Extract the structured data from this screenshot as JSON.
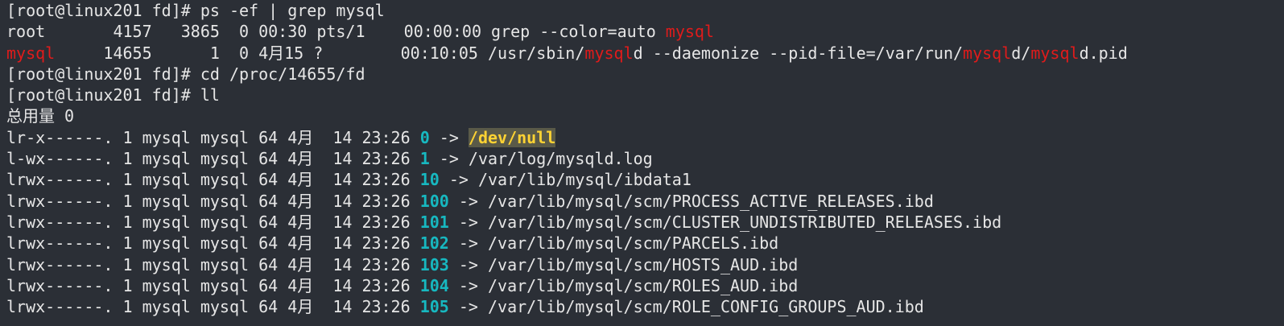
{
  "terminal": {
    "prompt": "[root@linux201 fd]# ",
    "commands": {
      "grep": "ps -ef | grep mysql",
      "cd": "cd /proc/14655/fd",
      "ll": "ll"
    },
    "ps_rows": {
      "grep_row": {
        "prefix": "root       4157   3865  0 00:30 pts/1    00:00:00 grep --color=auto ",
        "match": "mysql"
      },
      "mysqld_row": {
        "user": "mysql",
        "mid1": "     14655      1  0 4月15 ?        00:10:05 /usr/sbin/",
        "m1": "mysql",
        "mid2": "d --daemonize --pid-file=/var/run/",
        "m2": "mysql",
        "mid3": "d/",
        "m3": "mysql",
        "tail": "d.pid"
      }
    },
    "total_line": "总用量 0",
    "listing": [
      {
        "perm": "lr-x------.",
        "meta": " 1 mysql mysql 64 4月  14 23:26 ",
        "fd": "0",
        "arrow": " -> ",
        "target": "/dev/null"
      },
      {
        "perm": "l-wx------.",
        "meta": " 1 mysql mysql 64 4月  14 23:26 ",
        "fd": "1",
        "arrow": " -> ",
        "target": "/var/log/mysqld.log"
      },
      {
        "perm": "lrwx------.",
        "meta": " 1 mysql mysql 64 4月  14 23:26 ",
        "fd": "10",
        "arrow": " -> ",
        "target": "/var/lib/mysql/ibdata1"
      },
      {
        "perm": "lrwx------.",
        "meta": " 1 mysql mysql 64 4月  14 23:26 ",
        "fd": "100",
        "arrow": " -> ",
        "target": "/var/lib/mysql/scm/PROCESS_ACTIVE_RELEASES.ibd"
      },
      {
        "perm": "lrwx------.",
        "meta": " 1 mysql mysql 64 4月  14 23:26 ",
        "fd": "101",
        "arrow": " -> ",
        "target": "/var/lib/mysql/scm/CLUSTER_UNDISTRIBUTED_RELEASES.ibd"
      },
      {
        "perm": "lrwx------.",
        "meta": " 1 mysql mysql 64 4月  14 23:26 ",
        "fd": "102",
        "arrow": " -> ",
        "target": "/var/lib/mysql/scm/PARCELS.ibd"
      },
      {
        "perm": "lrwx------.",
        "meta": " 1 mysql mysql 64 4月  14 23:26 ",
        "fd": "103",
        "arrow": " -> ",
        "target": "/var/lib/mysql/scm/HOSTS_AUD.ibd"
      },
      {
        "perm": "lrwx------.",
        "meta": " 1 mysql mysql 64 4月  14 23:26 ",
        "fd": "104",
        "arrow": " -> ",
        "target": "/var/lib/mysql/scm/ROLES_AUD.ibd"
      },
      {
        "perm": "lrwx------.",
        "meta": " 1 mysql mysql 64 4月  14 23:26 ",
        "fd": "105",
        "arrow": " -> ",
        "target": "/var/lib/mysql/scm/ROLE_CONFIG_GROUPS_AUD.ibd"
      }
    ],
    "colors": {
      "background": "#2b2f36",
      "text": "#e6e6e6",
      "match_red": "#e01b1b",
      "fd_cyan": "#17b8c0",
      "devnull_yellow": "#ffd333"
    }
  }
}
